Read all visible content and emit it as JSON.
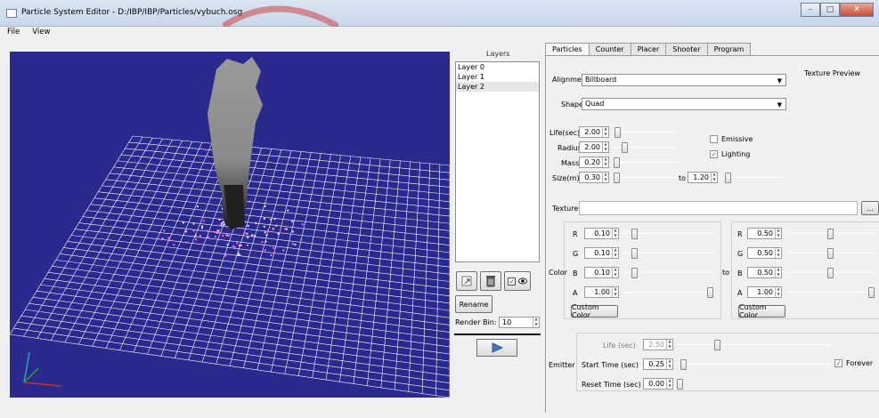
{
  "window": {
    "title": "Particle System Editor - D:/IBP/IBP/Particles/vybuch.osg"
  },
  "menu": {
    "file": "File",
    "view": "View"
  },
  "layers": {
    "header": "Layers",
    "items": [
      "Layer 0",
      "Layer 1",
      "Layer 2"
    ],
    "selected": "Layer 2",
    "visible_checked": true,
    "rename_label": "Rename",
    "render_bin_label": "Render Bin:",
    "render_bin_value": "10"
  },
  "tabs": [
    "Particles",
    "Counter",
    "Placer",
    "Shooter",
    "Program"
  ],
  "active_tab": "Particles",
  "particles": {
    "alignment_label": "Alignment:",
    "alignment_value": "Billboard",
    "texture_preview_label": "Texture Preview",
    "shape_label": "Shape",
    "shape_value": "Quad",
    "life_label": "Life(sec)",
    "life_value": "2.00",
    "radius_label": "Radius",
    "radius_value": "2.00",
    "mass_label": "Mass",
    "mass_value": "0.20",
    "size_label": "Size(m)",
    "size_from": "0.30",
    "size_to_label": "to",
    "size_to": "1.20",
    "emissive_label": "Emissive",
    "emissive_checked": false,
    "lighting_label": "Lighting",
    "lighting_checked": true,
    "texture_label": "Texture",
    "texture_value": "",
    "browse_label": "...",
    "color_label": "Color",
    "color_to_label": "to",
    "color_from": {
      "R": "0.10",
      "G": "0.10",
      "B": "0.10",
      "A": "1.00"
    },
    "color_to": {
      "R": "0.50",
      "G": "0.50",
      "B": "0.50",
      "A": "1.00"
    },
    "custom_color_label": "Custom Color",
    "emitter_label": "Emitter",
    "emitter_life_label": "Life (sec)",
    "emitter_life_value": "2.50",
    "start_time_label": "Start Time (sec)",
    "start_time_value": "0.25",
    "reset_time_label": "Reset Time (sec)",
    "reset_time_value": "0.00",
    "forever_label": "Forever",
    "forever_checked": true
  }
}
